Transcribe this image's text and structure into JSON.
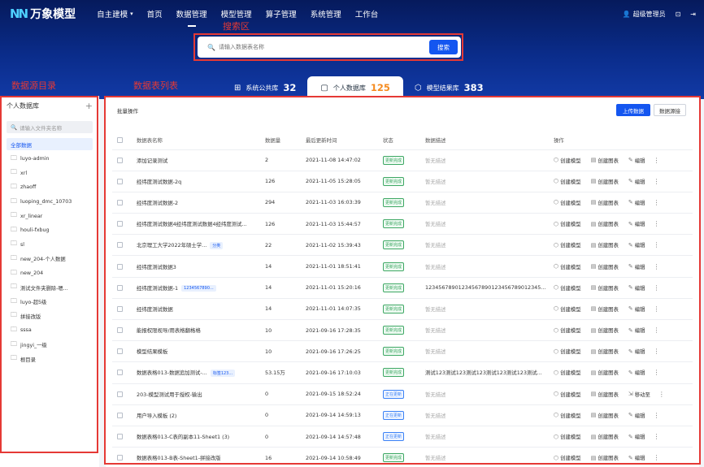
{
  "app": {
    "logo_mark": "NN",
    "name": "万象模型"
  },
  "nav": {
    "items": [
      {
        "label": "自主建模",
        "caret": "▾",
        "active": false
      },
      {
        "label": "首页",
        "caret": "",
        "active": false
      },
      {
        "label": "数据管理",
        "caret": "",
        "active": true
      },
      {
        "label": "模型管理",
        "caret": "",
        "active": false
      },
      {
        "label": "算子管理",
        "caret": "",
        "active": false
      },
      {
        "label": "系统管理",
        "caret": "",
        "active": false
      },
      {
        "label": "工作台",
        "caret": "",
        "active": false
      }
    ],
    "user": "超级管理员",
    "user_icon": "user-icon"
  },
  "annotations": {
    "search_area": "搜索区",
    "source_dir": "数据源目录",
    "table_list": "数据表列表"
  },
  "search": {
    "placeholder": "请输入数据表名称",
    "button": "搜索"
  },
  "tabs": [
    {
      "label": "系统公共库",
      "count": "32",
      "icon": "grid-icon",
      "active": false
    },
    {
      "label": "个人数据库",
      "count": "125",
      "icon": "document-icon",
      "active": true
    },
    {
      "label": "模型结果库",
      "count": "383",
      "icon": "cube-icon",
      "active": false
    }
  ],
  "sidebar": {
    "title": "个人数据库",
    "add": "+",
    "search_placeholder": "请输入文件夹名称",
    "all_label": "全部数据",
    "folders": [
      "luyo-admin",
      "xrl",
      "zhaoff",
      "luoping_dmc_10703",
      "xr_linear",
      "houli-fxbug",
      "sl",
      "new_204-个人数据",
      "new_204",
      "测试文件夹删除-嗯...",
      "luyo-超5级",
      "拼接改版",
      "sssa",
      "jingyi_一级",
      "根目录"
    ]
  },
  "panel": {
    "batch": "批量操作",
    "upload": "上传数据",
    "connect": "数据源接",
    "columns": [
      "数据表名称",
      "数据量",
      "最后更新时间",
      "状态",
      "数据描述",
      "操作"
    ],
    "rows": [
      {
        "name": "添加记录测试",
        "tag": "",
        "count": "2",
        "time": "2021-11-08 14:47:02",
        "status": "更新完成",
        "status_type": "green",
        "desc": "暂无描述",
        "desc_empty": true,
        "ops": [
          "创建模型",
          "创建图表",
          "编辑"
        ]
      },
      {
        "name": "经纬度测试数据-2q",
        "tag": "",
        "count": "126",
        "time": "2021-11-05 15:28:05",
        "status": "更新完成",
        "status_type": "green",
        "desc": "暂无描述",
        "desc_empty": true,
        "ops": [
          "创建模型",
          "创建图表",
          "编辑"
        ]
      },
      {
        "name": "经纬度测试数据-2",
        "tag": "",
        "count": "294",
        "time": "2021-11-03 16:03:39",
        "status": "更新完成",
        "status_type": "green",
        "desc": "暂无描述",
        "desc_empty": true,
        "ops": [
          "创建模型",
          "创建图表",
          "编辑"
        ]
      },
      {
        "name": "经纬度测试数据4经纬度测试数据4经纬度测试...",
        "tag": "",
        "count": "126",
        "time": "2021-11-03 15:44:57",
        "status": "更新完成",
        "status_type": "green",
        "desc": "暂无描述",
        "desc_empty": true,
        "ops": [
          "创建模型",
          "创建图表",
          "编辑"
        ]
      },
      {
        "name": "北京理工大学2022年硕士学...",
        "tag": "分类",
        "count": "22",
        "time": "2021-11-02 15:39:43",
        "status": "更新完成",
        "status_type": "green",
        "desc": "暂无描述",
        "desc_empty": true,
        "ops": [
          "创建模型",
          "创建图表",
          "编辑"
        ]
      },
      {
        "name": "经纬度测试数据3",
        "tag": "",
        "count": "14",
        "time": "2021-11-01 18:51:41",
        "status": "更新完成",
        "status_type": "green",
        "desc": "暂无描述",
        "desc_empty": true,
        "ops": [
          "创建模型",
          "创建图表",
          "编辑"
        ]
      },
      {
        "name": "经纬度测试数据-1",
        "tag": "1234567890...",
        "count": "14",
        "time": "2021-11-01 15:20:16",
        "status": "更新完成",
        "status_type": "green",
        "desc": "12345678901234567890123456789012345...",
        "desc_empty": false,
        "ops": [
          "创建模型",
          "创建图表",
          "编辑"
        ]
      },
      {
        "name": "经纬度测试数据",
        "tag": "",
        "count": "14",
        "time": "2021-11-01 14:07:35",
        "status": "更新完成",
        "status_type": "green",
        "desc": "暂无描述",
        "desc_empty": true,
        "ops": [
          "创建模型",
          "创建图表",
          "编辑"
        ]
      },
      {
        "name": "能报权限视导/用表格翻格格",
        "tag": "",
        "count": "10",
        "time": "2021-09-16 17:28:35",
        "status": "更新完成",
        "status_type": "green",
        "desc": "暂无描述",
        "desc_empty": true,
        "ops": [
          "创建模型",
          "创建图表",
          "编辑"
        ]
      },
      {
        "name": "模型结果模板",
        "tag": "",
        "count": "10",
        "time": "2021-09-16 17:26:25",
        "status": "更新完成",
        "status_type": "green",
        "desc": "暂无描述",
        "desc_empty": true,
        "ops": [
          "创建模型",
          "创建图表",
          "编辑"
        ]
      },
      {
        "name": "数据表格013-数据追加测试-...",
        "tag": "标签123...",
        "count": "53.15万",
        "time": "2021-09-16 17:10:03",
        "status": "更新完成",
        "status_type": "green",
        "desc": "测试123测试123测试123测试123测试123测试...",
        "desc_empty": false,
        "ops": [
          "创建模型",
          "创建图表",
          "编辑"
        ]
      },
      {
        "name": "203-模型测试用于授权-输出",
        "tag": "",
        "count": "0",
        "time": "2021-09-15 18:52:24",
        "status": "正在更新",
        "status_type": "blue",
        "desc": "暂无描述",
        "desc_empty": true,
        "ops": [
          "创建模型",
          "创建图表",
          "移动至"
        ]
      },
      {
        "name": "用户导入模板 (2)",
        "tag": "",
        "count": "0",
        "time": "2021-09-14 14:59:13",
        "status": "正在更新",
        "status_type": "blue",
        "desc": "暂无描述",
        "desc_empty": true,
        "ops": [
          "创建模型",
          "创建图表",
          "编辑"
        ]
      },
      {
        "name": "数据表格013-C表的副本11-Sheet1 (3)",
        "tag": "",
        "count": "0",
        "time": "2021-09-14 14:57:48",
        "status": "正在更新",
        "status_type": "blue",
        "desc": "暂无描述",
        "desc_empty": true,
        "ops": [
          "创建模型",
          "创建图表",
          "编辑"
        ]
      },
      {
        "name": "数据表格013-B表-Sheet1-拼接改版",
        "tag": "",
        "count": "16",
        "time": "2021-09-14 10:58:49",
        "status": "更新完成",
        "status_type": "green",
        "desc": "暂无描述",
        "desc_empty": true,
        "ops": [
          "创建模型",
          "创建图表",
          "编辑"
        ]
      }
    ]
  },
  "colors": {
    "brand": "#1456f0",
    "header_dark": "#061a5c",
    "accent_count": "#f58b1f",
    "annotation": "#e53935",
    "status_done": "#3ea864",
    "status_updating": "#3b82f6"
  }
}
